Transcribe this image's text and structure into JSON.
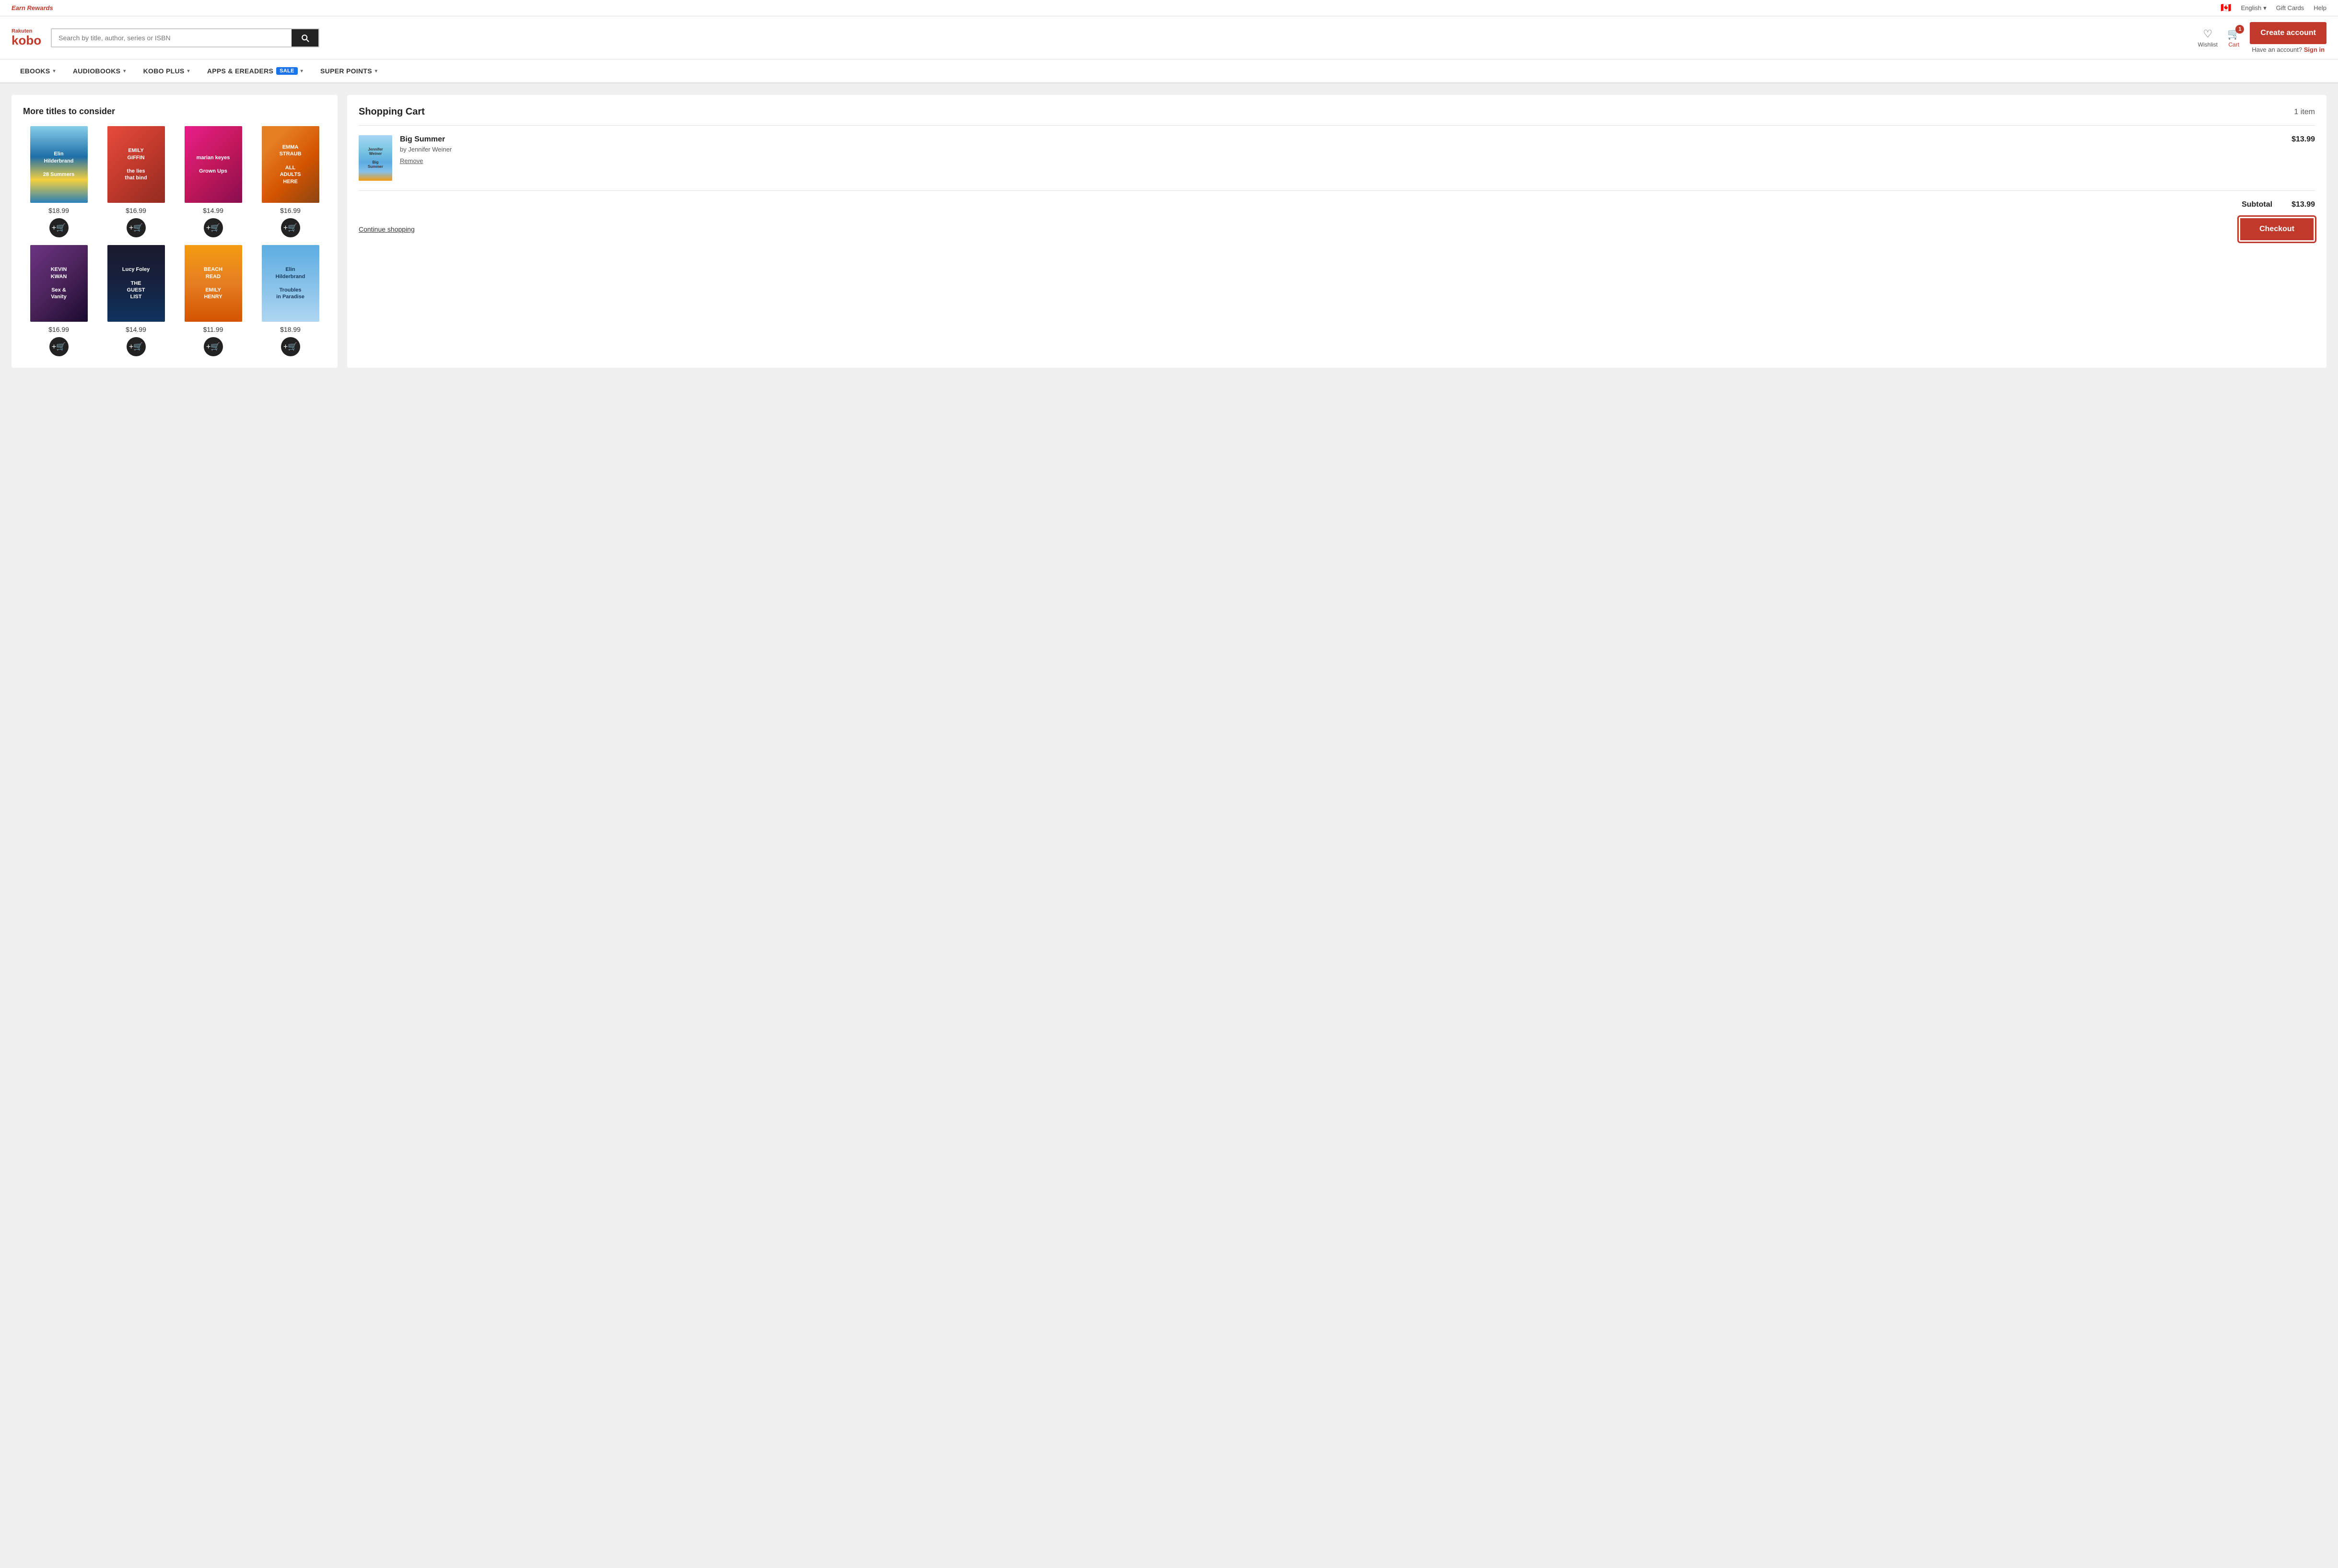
{
  "topBar": {
    "earnRewards": "Earn Rewards",
    "flag": "🇨🇦",
    "language": "English",
    "giftCards": "Gift Cards",
    "help": "Help"
  },
  "header": {
    "logoRakuten": "Rakuten",
    "logoKobo": "kobo",
    "searchPlaceholder": "Search by title, author, series or ISBN",
    "wishlistLabel": "Wishlist",
    "cartLabel": "Cart",
    "cartCount": "1",
    "createAccount": "Create account",
    "haveAccount": "Have an account?",
    "signIn": "Sign in"
  },
  "nav": {
    "items": [
      {
        "label": "eBOOKS",
        "hasDropdown": true
      },
      {
        "label": "AUDIOBOOKS",
        "hasDropdown": true
      },
      {
        "label": "KOBO PLUS",
        "hasDropdown": true
      },
      {
        "label": "APPS & eREADERS",
        "hasDropdown": true,
        "hasSale": true
      },
      {
        "label": "SUPER POINTS",
        "hasDropdown": true
      }
    ],
    "saleBadge": "SALE"
  },
  "leftPanel": {
    "sectionTitle": "More titles to consider",
    "books": [
      {
        "id": "28summers",
        "title": "Elin Hilderbrand 28 Summers",
        "price": "$18.99",
        "colorClass": "book-28summers"
      },
      {
        "id": "lies",
        "title": "Emily Giffin the lies that bind",
        "price": "$16.99",
        "colorClass": "book-lies"
      },
      {
        "id": "grownups",
        "title": "marian keyes Grown Ups",
        "price": "$14.99",
        "colorClass": "book-grownups"
      },
      {
        "id": "alladults",
        "title": "Emma Straub ALL ADULTS HERE",
        "price": "$16.99",
        "colorClass": "book-alladults"
      },
      {
        "id": "sexvanity",
        "title": "Kevin Kwan Sex and Vanity",
        "price": "$16.99",
        "colorClass": "book-sexvanity"
      },
      {
        "id": "guestlist",
        "title": "Lucy Foley The Guest List",
        "price": "$14.99",
        "colorClass": "book-guestlist"
      },
      {
        "id": "beachread",
        "title": "Beach Read Emily Henry",
        "price": "$11.99",
        "colorClass": "book-beachread"
      },
      {
        "id": "troubles",
        "title": "Elin Hilderbrand Troubles in Paradise",
        "price": "$18.99",
        "colorClass": "book-troubles"
      }
    ],
    "addToCartSymbol": "+"
  },
  "rightPanel": {
    "cartTitle": "Shopping Cart",
    "cartCount": "1 item",
    "cartItem": {
      "title": "Big Summer",
      "author": "by Jennifer Weiner",
      "price": "$13.99",
      "removeLabel": "Remove"
    },
    "subtotalLabel": "Subtotal",
    "subtotalValue": "$13.99",
    "continueShopping": "Continue shopping",
    "checkout": "Checkout"
  }
}
